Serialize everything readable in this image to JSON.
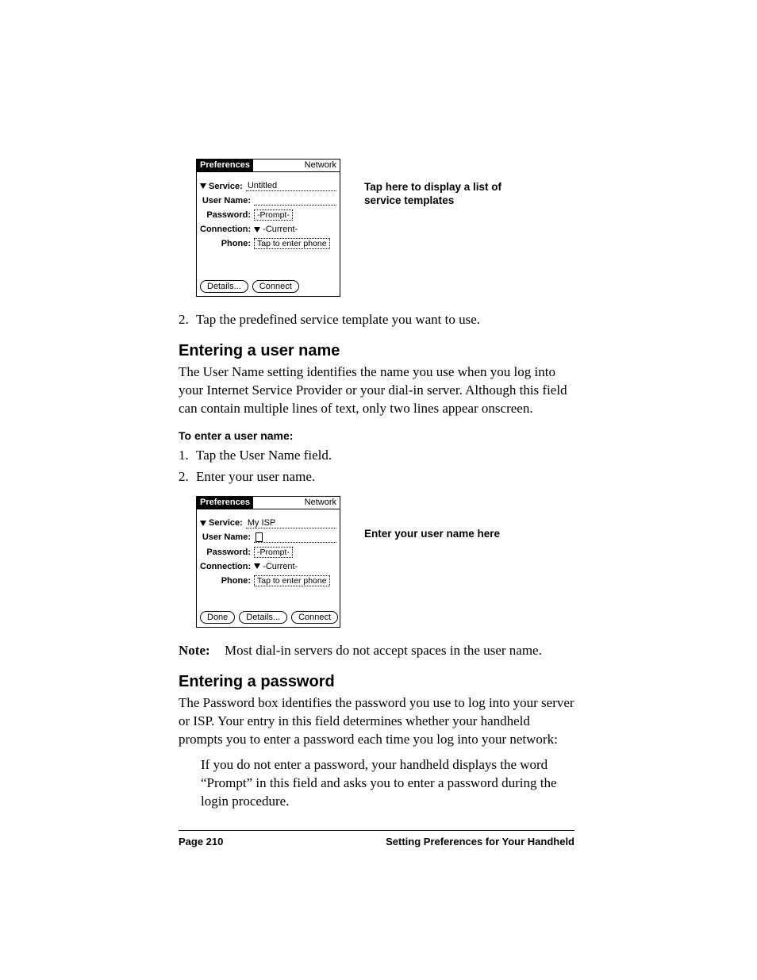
{
  "fig1": {
    "title": "Preferences",
    "menu": "Network",
    "service_label": "Service:",
    "service_value": "Untitled",
    "username_label": "User Name:",
    "username_value": "",
    "password_label": "Password:",
    "password_value": "-Prompt-",
    "connection_label": "Connection:",
    "connection_value": "-Current-",
    "phone_label": "Phone:",
    "phone_value": "Tap to enter phone",
    "btn_details": "Details...",
    "btn_connect": "Connect",
    "callout": "Tap here to display a list of service templates"
  },
  "step_after_fig1": {
    "num": "2.",
    "text": "Tap the predefined service template you want to use."
  },
  "section1": {
    "heading": "Entering a user name",
    "para": "The User Name setting identifies the name you use when you log into your Internet Service Provider or your dial-in server. Although this field can contain multiple lines of text, only two lines appear onscreen.",
    "subhead": "To enter a user name:",
    "steps": [
      {
        "num": "1.",
        "text": "Tap the User Name field."
      },
      {
        "num": "2.",
        "text": "Enter your user name."
      }
    ]
  },
  "fig2": {
    "title": "Preferences",
    "menu": "Network",
    "service_label": "Service:",
    "service_value": "My ISP",
    "username_label": "User Name:",
    "password_label": "Password:",
    "password_value": "-Prompt-",
    "connection_label": "Connection:",
    "connection_value": "-Current-",
    "phone_label": "Phone:",
    "phone_value": "Tap to enter phone",
    "btn_done": "Done",
    "btn_details": "Details...",
    "btn_connect": "Connect",
    "callout": "Enter your user name here"
  },
  "note": {
    "label": "Note:",
    "text": "Most dial-in servers do not accept spaces in the user name."
  },
  "section2": {
    "heading": "Entering a password",
    "para": "The Password box identifies the password you use to log into your server or ISP. Your entry in this field determines whether your handheld prompts you to enter a password each time you log into your network:",
    "sub": "If you do not enter a password, your handheld displays the word “Prompt” in this field and asks you to enter a password during the login procedure."
  },
  "footer": {
    "page": "Page 210",
    "chapter": "Setting Preferences for Your Handheld"
  }
}
